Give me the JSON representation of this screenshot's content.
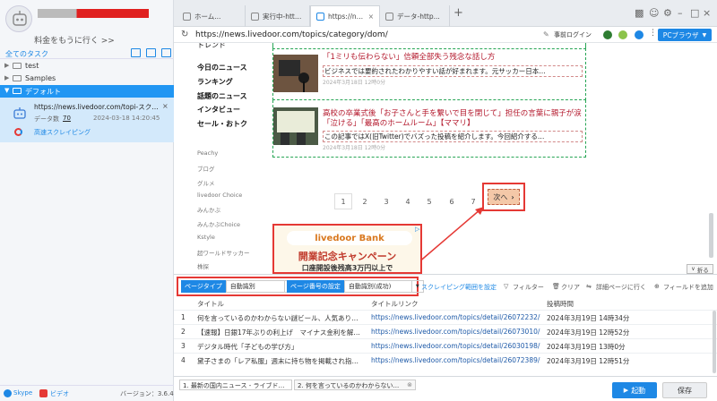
{
  "sidebar": {
    "upgrade": "料金をもうに行く >>",
    "all_tasks": "全てのタスク",
    "folders": [
      {
        "name": "test"
      },
      {
        "name": "Samples"
      },
      {
        "name": "デフォルト"
      }
    ],
    "task": {
      "title": "https://news.livedoor.com/topi-スクレイピン...",
      "count_label": "データ数",
      "count": "70",
      "time": "2024-03-18 14:20:45",
      "mode": "高速スクレイピング"
    },
    "skype": "Skype",
    "video": "ビデオ",
    "version": "バージョン：3.6.4"
  },
  "tabs": [
    {
      "label": "ホーム..."
    },
    {
      "label": "実行中-http..."
    },
    {
      "label": "https://new..."
    },
    {
      "label": "データ-http..."
    }
  ],
  "address": {
    "url": "https://news.livedoor.com/topics/category/dom/",
    "login": "事前ログイン",
    "mode": "PCブラウザ"
  },
  "web": {
    "nav_top": "トレンド",
    "nav_bold": [
      "今日のニュース",
      "ランキング",
      "話題のニュース",
      "インタビュー",
      "セール・おトク"
    ],
    "nav_light": [
      "Peachy",
      "ブログ",
      "グルメ",
      "livedoor Choice",
      "みんかぶ",
      "みんかぶChoice",
      "Kstyle",
      "超ワールドサッカー",
      "株探"
    ],
    "articles": [
      {
        "title": "「1ミリも伝わらない」信頼全部失う残念な話し方",
        "desc": "ビジネスでは要約されたわかりやすい話が好まれます。元サッカー日本…",
        "date": "2024年3月18日 12時0分"
      },
      {
        "title": "高校の卒業式後「お子さんと手を繋いで目を閉じて」担任の言葉に親子が涙「泣ける」「最高のホームルーム」【ママリ】",
        "desc": "この記事ではX(旧Twitter)でバズった投稿を紹介します。今回紹介する…",
        "date": "2024年3月18日 12時0分"
      }
    ],
    "pages": [
      "1",
      "2",
      "3",
      "4",
      "5",
      "6",
      "7"
    ],
    "next": "次へ",
    "ad": {
      "brand": "livedoor Bank",
      "headline": "開業記念キャンペーン",
      "sub": "口座開設後残高3万円以上で"
    },
    "collapse": "折る"
  },
  "panel": {
    "page_type_label": "ページタイプ",
    "page_type_value": "自動識別",
    "page_num_label": "ページ番号の設定",
    "page_num_value": "自動識別(成功)",
    "range": "スクレイピング範囲を設定",
    "filter": "フィルター",
    "clear": "クリア",
    "detail": "詳細ページに行く",
    "add_field": "フィールドを追加",
    "columns": [
      "タイトル",
      "タイトルリンク",
      "投稿時間"
    ],
    "rows": [
      {
        "n": "1",
        "title": "何を言っているのかわからない謎ビール、人気ありすぎて入...",
        "link": "https://news.livedoor.com/topics/detail/26072232/",
        "time": "2024年3月19日 14時34分"
      },
      {
        "n": "2",
        "title": "【速報】日銀17年ぶりの利上げ　マイナス金利を解除　YCC...",
        "link": "https://news.livedoor.com/topics/detail/26073010/",
        "time": "2024年3月19日 12時52分"
      },
      {
        "n": "3",
        "title": "デジタル時代「子どもの学び方」",
        "link": "https://news.livedoor.com/topics/detail/26030198/",
        "time": "2024年3月19日 13時0分"
      },
      {
        "n": "4",
        "title": "黛子さまの「レア私服」週末に持ち物を掲載され指摘な声に...",
        "link": "https://news.livedoor.com/topics/detail/26072389/",
        "time": "2024年3月19日 12時51分"
      }
    ]
  },
  "status": {
    "tabs": [
      "1. 最新の国内ニュース - ライブドア...",
      "2. 何を言っているのかわからない..."
    ],
    "start": "起動",
    "save": "保存"
  },
  "colors": {
    "accent": "#1e88e5",
    "link_red": "#b3172b",
    "highlight": "#e53935",
    "dashed_green": "#27a555"
  }
}
